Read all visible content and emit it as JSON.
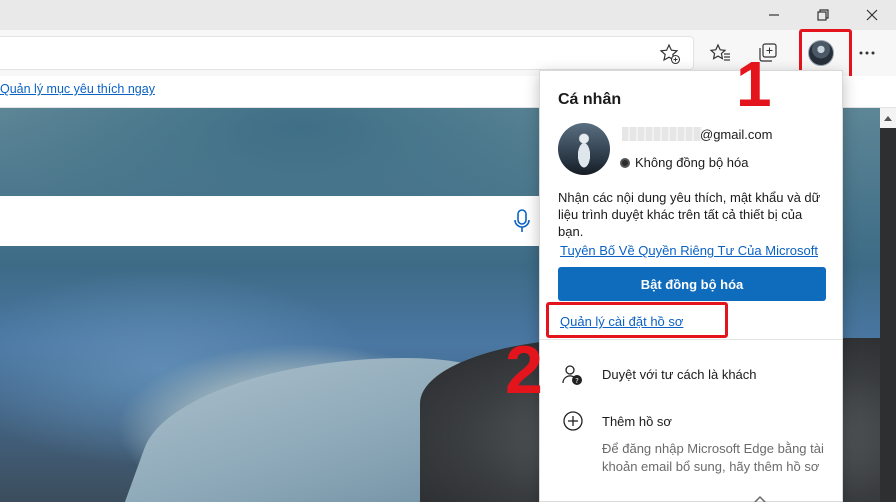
{
  "window": {
    "minimize_icon": "minimize-icon",
    "restore_icon": "restore-icon",
    "close_icon": "close-icon"
  },
  "toolbar": {
    "icons": [
      "add-favorite-icon",
      "favorites-icon",
      "collections-icon",
      "profile-avatar",
      "more-icon"
    ]
  },
  "favorites_bar": {
    "link": "Quản lý mục yêu thích ngay"
  },
  "profile_panel": {
    "title": "Cá nhân",
    "email": "@gmail.com",
    "sync_status": "Không đồng bộ hóa",
    "description": "Nhận các nội dung yêu thích, mật khẩu và dữ liệu trình duyệt khác trên tất cả thiết bị của bạn.",
    "privacy_link": "Tuyên Bố Về Quyền Riêng Tư Của Microsoft",
    "sync_button": "Bật đồng bộ hóa",
    "manage_link": "Quản lý cài đặt hồ sơ",
    "guest_label": "Duyệt với tư cách là khách",
    "add_profile_label": "Thêm hồ sơ",
    "add_profile_desc": "Để đăng nhập Microsoft Edge bằng tài khoản email bổ sung, hãy thêm hồ sơ"
  },
  "annotations": {
    "step1": "1",
    "step2": "2",
    "highlight_color": "#e4141c"
  },
  "colors": {
    "accent": "#0f6cbd",
    "link": "#0b62c4"
  }
}
